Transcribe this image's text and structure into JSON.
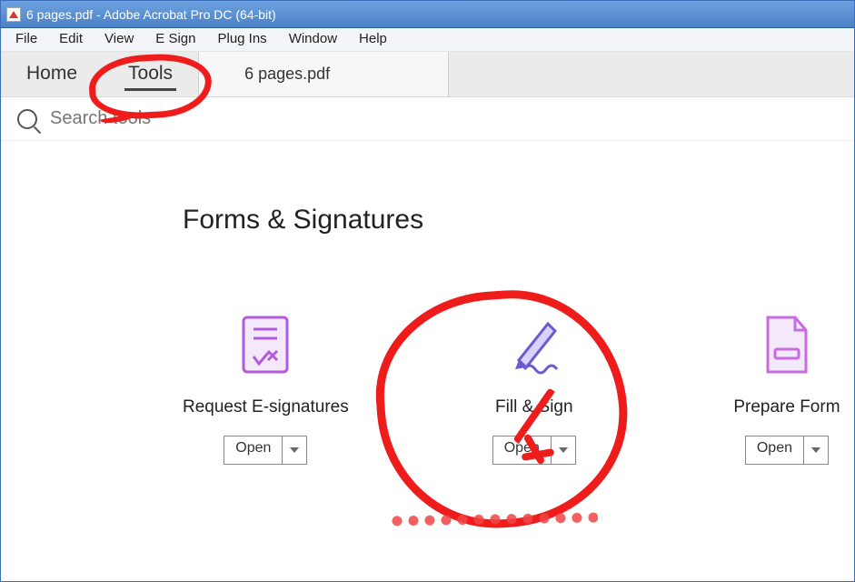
{
  "window": {
    "title": "6 pages.pdf - Adobe Acrobat Pro DC (64-bit)"
  },
  "menubar": {
    "items": [
      "File",
      "Edit",
      "View",
      "E Sign",
      "Plug Ins",
      "Window",
      "Help"
    ]
  },
  "tabbar": {
    "home": "Home",
    "tools": "Tools",
    "doc": "6 pages.pdf"
  },
  "search": {
    "placeholder": "Search tools"
  },
  "section": {
    "title": "Forms & Signatures"
  },
  "tools_list": [
    {
      "name": "Request E-signatures",
      "button": "Open"
    },
    {
      "name": "Fill & Sign",
      "button": "Open"
    },
    {
      "name": "Prepare Form",
      "button": "Open"
    }
  ]
}
